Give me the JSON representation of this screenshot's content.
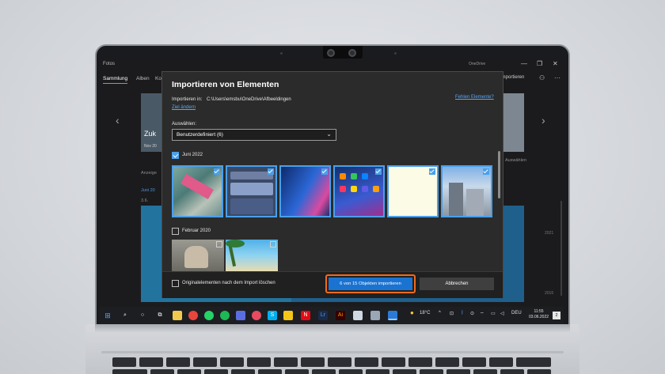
{
  "app": {
    "title": "Fotos",
    "onedrive": "OneDrive",
    "window_controls": [
      "—",
      "❐",
      "✕"
    ],
    "nav": [
      "Sammlung",
      "Alben",
      "Ko"
    ],
    "import_label": "Importieren",
    "hero_title": "Zuk",
    "hero_sub": "Nov 20",
    "left_text": "Anzeige",
    "left_text2": "Juni 20",
    "left_text3": "3.6.",
    "right_text": "Auswählen",
    "timeline_years": [
      "2021",
      "2016"
    ]
  },
  "dialog": {
    "title": "Importieren von Elementen",
    "path_label": "Importieren in:",
    "path": "C:\\Users\\emsbu\\OneDrive\\Afbeeldingen",
    "change_target": "Ziel ändern",
    "missing_link": "Fehlen Elemente?",
    "select_label": "Auswählen:",
    "select_value": "Benutzerdefiniert (6)",
    "groups": [
      {
        "label": "Juni 2022",
        "checked": true
      },
      {
        "label": "Februar 2020",
        "checked": false
      }
    ],
    "delete_option": "Originalelementen nach dem Import löschen",
    "primary_button": "6 von 15 Objekten importieren",
    "secondary_button": "Abbrechen"
  },
  "taskbar": {
    "weather": "18°C",
    "language": "DEU",
    "time": "11:55",
    "date": "03.06.2022",
    "notifications": "2"
  },
  "colors": {
    "accent": "#1a73d1",
    "highlight": "#f26a1b",
    "check": "#4a9fea"
  }
}
